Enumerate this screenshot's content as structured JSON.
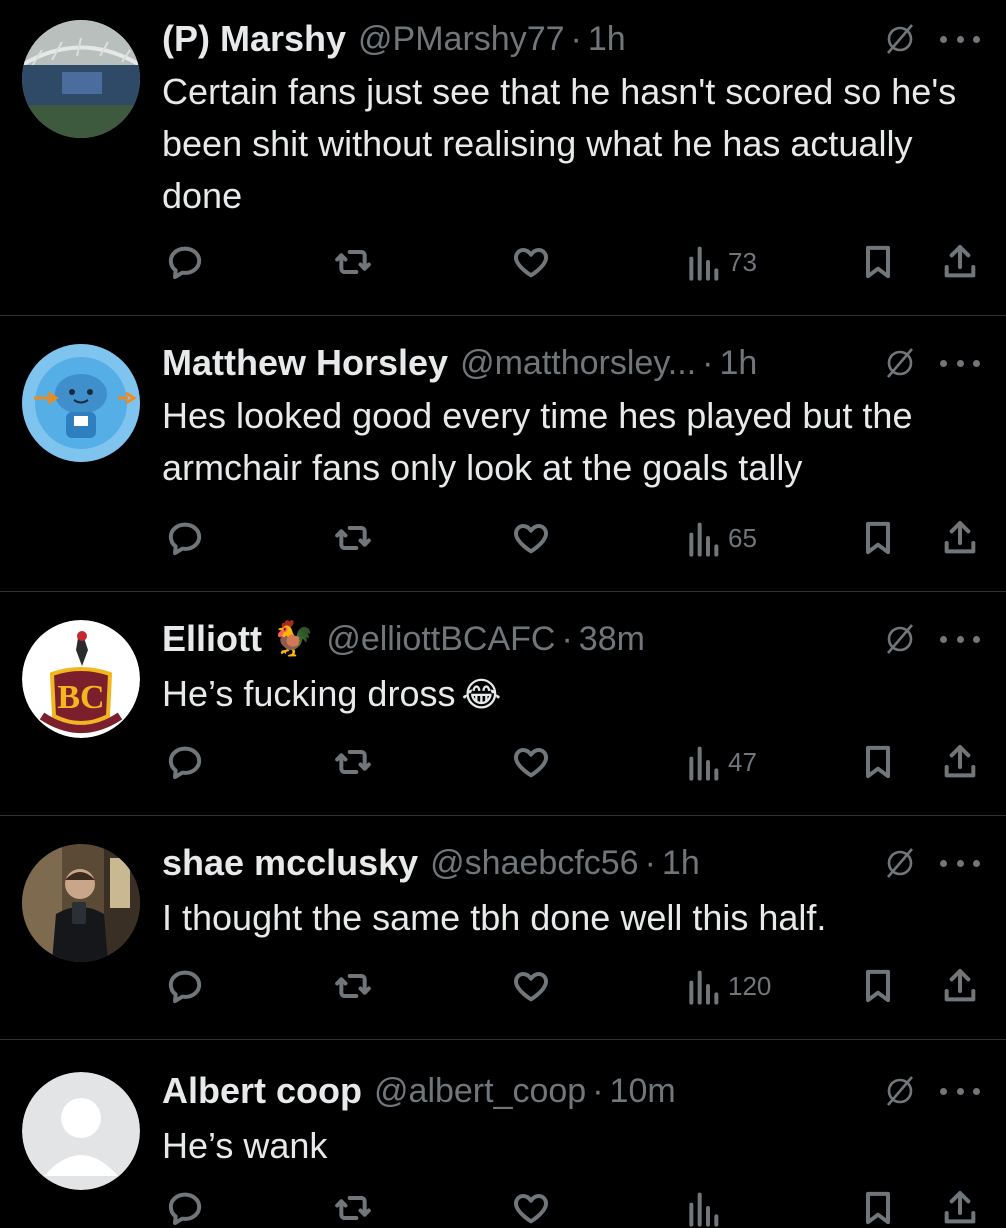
{
  "tweets": [
    {
      "display_name": "(P) Marshy",
      "handle": "@PMarshy77",
      "separator": "·",
      "time": "1h",
      "badge_emoji": "",
      "text": "Certain fans just see that he hasn't scored so he's been shit without realising what he has actually done",
      "trailing_emoji": "",
      "views": "73",
      "avatar": "stadium-photo"
    },
    {
      "display_name": "Matthew Horsley",
      "handle": "@matthorsley...",
      "separator": "·",
      "time": "1h",
      "badge_emoji": "",
      "text": "Hes looked good every time hes played but the armchair fans only look at the goals tally",
      "trailing_emoji": "",
      "views": "65",
      "avatar": "blue-mascot"
    },
    {
      "display_name": "Elliott",
      "handle": "@elliottBCAFC",
      "separator": "·",
      "time": "38m",
      "badge_emoji": "🐓",
      "text": "He’s fucking dross",
      "trailing_emoji": "😂",
      "views": "47",
      "avatar": "club-crest"
    },
    {
      "display_name": "shae mcclusky",
      "handle": "@shaebcfc56",
      "separator": "·",
      "time": "1h",
      "badge_emoji": "",
      "text": "I thought the same tbh done well this half.",
      "trailing_emoji": "",
      "views": "120",
      "avatar": "mirror-selfie"
    },
    {
      "display_name": "Albert coop",
      "handle": "@albert_coop",
      "separator": "·",
      "time": "10m",
      "badge_emoji": "",
      "text": "He’s wank",
      "trailing_emoji": "",
      "views": "",
      "avatar": "default-grey"
    }
  ],
  "colors": {
    "background": "#000000",
    "text": "#e7e9ea",
    "secondary": "#71767b",
    "divider": "#2f3336"
  },
  "icons": [
    "reply-icon",
    "retweet-icon",
    "like-icon",
    "views-icon",
    "bookmark-icon",
    "share-icon",
    "grok-icon",
    "more-icon"
  ]
}
